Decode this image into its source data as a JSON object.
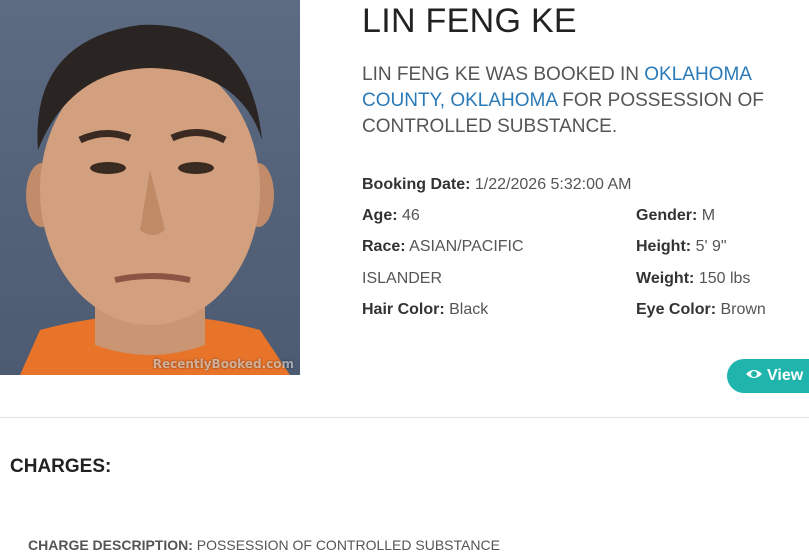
{
  "photo": {
    "watermark": "RecentlyBooked.com"
  },
  "person": {
    "name": "LIN FENG KE",
    "summary_prefix": "LIN FENG KE WAS BOOKED IN ",
    "summary_location": "OKLAHOMA COUNTY, OKLAHOMA",
    "summary_suffix": " FOR POSSESSION OF CONTROLLED SUBSTANCE."
  },
  "details": {
    "booking_date_label": "Booking Date:",
    "booking_date_value": "1/22/2026 5:32:00 AM",
    "age_label": "Age:",
    "age_value": "46",
    "gender_label": "Gender:",
    "gender_value": "M",
    "race_label": "Race:",
    "race_value_line1": "ASIAN/PACIFIC",
    "race_value_line2": "ISLANDER",
    "height_label": "Height:",
    "height_value": "5' 9\"",
    "weight_label": "Weight:",
    "weight_value": "150 lbs",
    "hair_label": "Hair Color:",
    "hair_value": "Black",
    "eye_label": "Eye Color:",
    "eye_value": "Brown"
  },
  "actions": {
    "view_label": "View"
  },
  "charges": {
    "title": "CHARGES:",
    "desc_label": "CHARGE DESCRIPTION:",
    "desc_value": "POSSESSION OF CONTROLLED SUBSTANCE"
  },
  "colors": {
    "link": "#2a7ab8",
    "button": "#1fb5ad"
  }
}
